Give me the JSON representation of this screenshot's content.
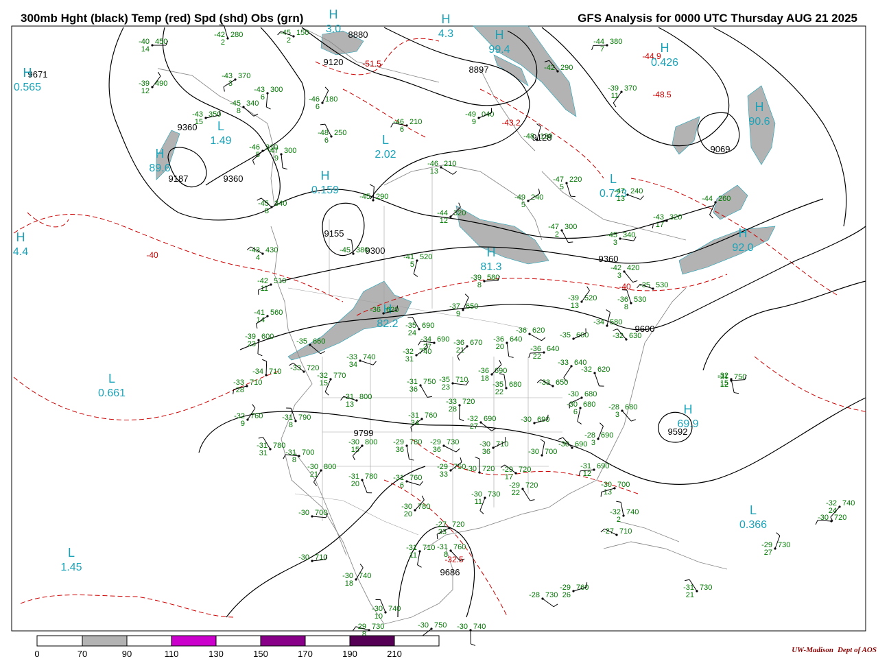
{
  "header": {
    "left_title": "300mb Hght (black) Temp (red) Spd (shd) Obs (grn)",
    "right_title": "GFS Analysis for 0000 UTC Thursday  AUG 21 2025"
  },
  "colors": {
    "height_contour": "#000000",
    "temp_contour": "#cc0000",
    "speed_shade": "#b3b3b3",
    "obs_text": "#007700",
    "coast": "#888888",
    "hl_label": "#1aa3b8"
  },
  "height_labels": [
    "9671",
    "9360",
    "9187",
    "9360",
    "9120",
    "8880",
    "9128",
    "9069",
    "9155",
    "9300",
    "9360",
    "9600",
    "9799",
    "9592",
    "9686",
    "8897"
  ],
  "temp_labels": [
    "-40",
    "-51.5",
    "-44.9",
    "-43.2",
    "-48.5",
    "-40",
    "-32.5"
  ],
  "hl_centers": [
    {
      "type": "H",
      "value": "0.565"
    },
    {
      "type": "L",
      "value": "1.49"
    },
    {
      "type": "H",
      "value": "89.6"
    },
    {
      "type": "L",
      "value": "2.02"
    },
    {
      "type": "H",
      "value": "99.4"
    },
    {
      "type": "H",
      "value": "0.426"
    },
    {
      "type": "H",
      "value": "90.6"
    },
    {
      "type": "L",
      "value": "0.723"
    },
    {
      "type": "H",
      "value": "0.159"
    },
    {
      "type": "H",
      "value": "4.4"
    },
    {
      "type": "H",
      "value": "92.0"
    },
    {
      "type": "H",
      "value": "81.3"
    },
    {
      "type": "H",
      "value": "82.2"
    },
    {
      "type": "L",
      "value": "0.661"
    },
    {
      "type": "H",
      "value": "69.9"
    },
    {
      "type": "L",
      "value": "0.366"
    },
    {
      "type": "L",
      "value": "1.45"
    },
    {
      "type": "H",
      "value": "3.0"
    },
    {
      "type": "H",
      "value": "4.3"
    }
  ],
  "observations": [
    {
      "t": "-40",
      "h": "450",
      "s": "14"
    },
    {
      "t": "-39",
      "h": "490",
      "s": "12"
    },
    {
      "t": "-42",
      "h": "280",
      "s": "2"
    },
    {
      "t": "-45",
      "h": "150",
      "s": "2"
    },
    {
      "t": "-43",
      "h": "370",
      "s": "3"
    },
    {
      "t": "-43",
      "h": "300",
      "s": "6"
    },
    {
      "t": "-45",
      "h": "340",
      "s": "8"
    },
    {
      "t": "-43",
      "h": "350",
      "s": "15"
    },
    {
      "t": "-46",
      "h": "180",
      "s": "6"
    },
    {
      "t": "-48",
      "h": "250",
      "s": "6"
    },
    {
      "t": "-46",
      "h": "210",
      "s": "6"
    },
    {
      "t": "-46",
      "h": "310",
      "s": "5"
    },
    {
      "t": "-47",
      "h": "300",
      "s": "9"
    },
    {
      "t": "-46",
      "h": "210",
      "s": "13"
    },
    {
      "t": "-49",
      "h": "040",
      "s": "9"
    },
    {
      "t": "-48",
      "h": "130",
      "s": ""
    },
    {
      "t": "-42",
      "h": "290",
      "s": ""
    },
    {
      "t": "-44",
      "h": "380",
      "s": "7"
    },
    {
      "t": "-39",
      "h": "370",
      "s": "11"
    },
    {
      "t": "-47",
      "h": "220",
      "s": "5"
    },
    {
      "t": "-47",
      "h": "240",
      "s": "13"
    },
    {
      "t": "-49",
      "h": "240",
      "s": "5"
    },
    {
      "t": "-45",
      "h": "290",
      "s": ""
    },
    {
      "t": "-45",
      "h": "340",
      "s": "8"
    },
    {
      "t": "-43",
      "h": "320",
      "s": "17"
    },
    {
      "t": "-44",
      "h": "260",
      "s": ""
    },
    {
      "t": "-47",
      "h": "300",
      "s": "2"
    },
    {
      "t": "-45",
      "h": "340",
      "s": "3"
    },
    {
      "t": "-44",
      "h": "320",
      "s": "12"
    },
    {
      "t": "-45",
      "h": "380",
      "s": ""
    },
    {
      "t": "-43",
      "h": "430",
      "s": "4"
    },
    {
      "t": "-42",
      "h": "510",
      "s": "11"
    },
    {
      "t": "-41",
      "h": "520",
      "s": "5"
    },
    {
      "t": "-42",
      "h": "420",
      "s": "3"
    },
    {
      "t": "-39",
      "h": "580",
      "s": "8"
    },
    {
      "t": "-39",
      "h": "520",
      "s": "13"
    },
    {
      "t": "-36",
      "h": "530",
      "s": "8"
    },
    {
      "t": "-35",
      "h": "530",
      "s": ""
    },
    {
      "t": "-41",
      "h": "560",
      "s": "14"
    },
    {
      "t": "-39",
      "h": "600",
      "s": "23"
    },
    {
      "t": "-35",
      "h": "660",
      "s": ""
    },
    {
      "t": "-36",
      "h": "620",
      "s": ""
    },
    {
      "t": "-37",
      "h": "650",
      "s": "9"
    },
    {
      "t": "-35",
      "h": "690",
      "s": "24"
    },
    {
      "t": "-34",
      "h": "690",
      "s": "27"
    },
    {
      "t": "-36",
      "h": "670",
      "s": "21"
    },
    {
      "t": "-36",
      "h": "640",
      "s": "20"
    },
    {
      "t": "-36",
      "h": "620",
      "s": ""
    },
    {
      "t": "-35",
      "h": "600",
      "s": ""
    },
    {
      "t": "-34",
      "h": "580",
      "s": ""
    },
    {
      "t": "-32",
      "h": "630",
      "s": ""
    },
    {
      "t": "-36",
      "h": "640",
      "s": "22"
    },
    {
      "t": "-33",
      "h": "640",
      "s": ""
    },
    {
      "t": "-32",
      "h": "620",
      "s": ""
    },
    {
      "t": "-33",
      "h": "740",
      "s": "34"
    },
    {
      "t": "-32",
      "h": "740",
      "s": "31"
    },
    {
      "t": "-34",
      "h": "710",
      "s": ""
    },
    {
      "t": "-33",
      "h": "720",
      "s": ""
    },
    {
      "t": "-33",
      "h": "710",
      "s": "28"
    },
    {
      "t": "-32",
      "h": "770",
      "s": "15"
    },
    {
      "t": "-31",
      "h": "750",
      "s": "36"
    },
    {
      "t": "-35",
      "h": "710",
      "s": "23"
    },
    {
      "t": "-36",
      "h": "690",
      "s": "18"
    },
    {
      "t": "-35",
      "h": "680",
      "s": "22"
    },
    {
      "t": "-33",
      "h": "650",
      "s": ""
    },
    {
      "t": "-30",
      "h": "680",
      "s": ""
    },
    {
      "t": "-30",
      "h": "680",
      "s": "6"
    },
    {
      "t": "-28",
      "h": "680",
      "s": "3"
    },
    {
      "t": "-31",
      "h": "750",
      "s": "12"
    },
    {
      "t": "-32",
      "h": "760",
      "s": "9"
    },
    {
      "t": "-31",
      "h": "790",
      "s": "8"
    },
    {
      "t": "-31",
      "h": "800",
      "s": "13"
    },
    {
      "t": "-31",
      "h": "760",
      "s": "34"
    },
    {
      "t": "-33",
      "h": "720",
      "s": "28"
    },
    {
      "t": "-32",
      "h": "690",
      "s": "27"
    },
    {
      "t": "-30",
      "h": "690",
      "s": ""
    },
    {
      "t": "-28",
      "h": "690",
      "s": "3"
    },
    {
      "t": "-31",
      "h": "780",
      "s": "31"
    },
    {
      "t": "-31",
      "h": "700",
      "s": "8"
    },
    {
      "t": "-30",
      "h": "800",
      "s": "15"
    },
    {
      "t": "-29",
      "h": "780",
      "s": "36"
    },
    {
      "t": "-29",
      "h": "730",
      "s": "36"
    },
    {
      "t": "-30",
      "h": "710",
      "s": "36"
    },
    {
      "t": "-30",
      "h": "700",
      "s": ""
    },
    {
      "t": "-30",
      "h": "690",
      "s": ""
    },
    {
      "t": "-31",
      "h": "690",
      "s": "12"
    },
    {
      "t": "-30",
      "h": "800",
      "s": "21"
    },
    {
      "t": "-31",
      "h": "780",
      "s": "20"
    },
    {
      "t": "-31",
      "h": "760",
      "s": "6"
    },
    {
      "t": "-29",
      "h": "750",
      "s": "33"
    },
    {
      "t": "-30",
      "h": "720",
      "s": ""
    },
    {
      "t": "-29",
      "h": "720",
      "s": "17"
    },
    {
      "t": "-30",
      "h": "700",
      "s": "13"
    },
    {
      "t": "-30",
      "h": "730",
      "s": "11"
    },
    {
      "t": "-29",
      "h": "720",
      "s": "22"
    },
    {
      "t": "-30",
      "h": "700",
      "s": ""
    },
    {
      "t": "-30",
      "h": "780",
      "s": "20"
    },
    {
      "t": "-32",
      "h": "740",
      "s": "2"
    },
    {
      "t": "-27",
      "h": "710",
      "s": ""
    },
    {
      "t": "-27",
      "h": "720",
      "s": "33"
    },
    {
      "t": "-31",
      "h": "710",
      "s": "11"
    },
    {
      "t": "-31",
      "h": "760",
      "s": "8"
    },
    {
      "t": "-30",
      "h": "710",
      "s": ""
    },
    {
      "t": "-30",
      "h": "740",
      "s": "18"
    },
    {
      "t": "-30",
      "h": "740",
      "s": "10"
    },
    {
      "t": "-29",
      "h": "730",
      "s": "8"
    },
    {
      "t": "-30",
      "h": "750",
      "s": ""
    },
    {
      "t": "-30",
      "h": "740",
      "s": ""
    },
    {
      "t": "-28",
      "h": "730",
      "s": ""
    },
    {
      "t": "-29",
      "h": "760",
      "s": "26"
    },
    {
      "t": "-29",
      "h": "730",
      "s": "27"
    },
    {
      "t": "-31",
      "h": "730",
      "s": "21"
    },
    {
      "t": "-30",
      "h": "720",
      "s": ""
    },
    {
      "t": "-32",
      "h": "740",
      "s": "24"
    },
    {
      "t": "-32",
      "h": "",
      "s": "15"
    },
    {
      "t": "-31",
      "h": "750",
      "s": "12"
    }
  ],
  "colorbar": {
    "ticks": [
      "0",
      "70",
      "90",
      "110",
      "130",
      "150",
      "170",
      "190",
      "210"
    ],
    "bands": [
      {
        "from": 0,
        "to": 70,
        "color": "#ffffff"
      },
      {
        "from": 70,
        "to": 90,
        "color": "#b3b3b3"
      },
      {
        "from": 90,
        "to": 110,
        "color": "#ffffff"
      },
      {
        "from": 110,
        "to": 130,
        "color": "#cc00cc"
      },
      {
        "from": 130,
        "to": 150,
        "color": "#ffffff"
      },
      {
        "from": 150,
        "to": 170,
        "color": "#880088"
      },
      {
        "from": 170,
        "to": 190,
        "color": "#ffffff"
      },
      {
        "from": 190,
        "to": 210,
        "color": "#550055"
      },
      {
        "from": 210,
        "to": 230,
        "color": "#ffffff"
      }
    ]
  },
  "credit": {
    "org": "UW-Madison",
    "dept": "Dept of AOS"
  }
}
